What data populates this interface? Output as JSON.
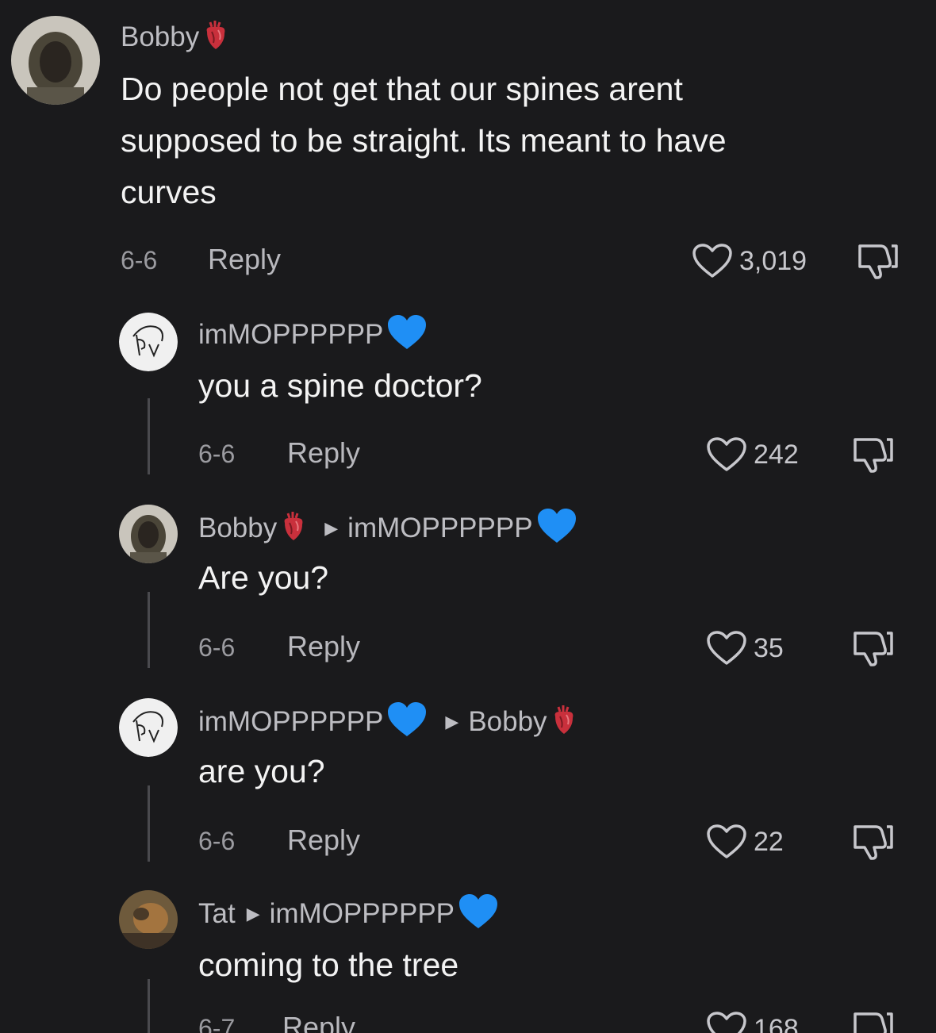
{
  "colors": {
    "background": "#1a1a1c",
    "username": "#bdbdc2",
    "text": "#f3f3f3",
    "muted": "#9b9ba0",
    "blue_heart": "#1f8ff5",
    "anatomical_heart": "#c9303c"
  },
  "comments": [
    {
      "author": "Bobby",
      "author_badge": "anatomical-heart-icon",
      "reply_to": "",
      "text_lines": [
        "Do people not get that our spines arent",
        "supposed to be straight. Its meant to have",
        "curves"
      ],
      "date": "6-6",
      "reply_label": "Reply",
      "likes": "3,019"
    },
    {
      "author": "imMOPPPPPP",
      "author_badge": "blue-heart-icon",
      "reply_to": "",
      "text_lines": [
        "you a spine doctor?"
      ],
      "date": "6-6",
      "reply_label": "Reply",
      "likes": "242"
    },
    {
      "author": "Bobby",
      "author_badge": "anatomical-heart-icon",
      "reply_to": "imMOPPPPPP",
      "reply_to_badge": "blue-heart-icon",
      "text_lines": [
        "Are you?"
      ],
      "date": "6-6",
      "reply_label": "Reply",
      "likes": "35"
    },
    {
      "author": "imMOPPPPPP",
      "author_badge": "blue-heart-icon",
      "reply_to": "Bobby",
      "reply_to_badge": "anatomical-heart-icon",
      "text_lines": [
        "are you?"
      ],
      "date": "6-6",
      "reply_label": "Reply",
      "likes": "22"
    },
    {
      "author": "Tat",
      "reply_to": "imMOPPPPPP",
      "reply_to_badge": "blue-heart-icon",
      "text_lines": [
        "coming to the tree"
      ],
      "date": "6-7",
      "reply_label": "Reply",
      "likes": "168"
    }
  ]
}
